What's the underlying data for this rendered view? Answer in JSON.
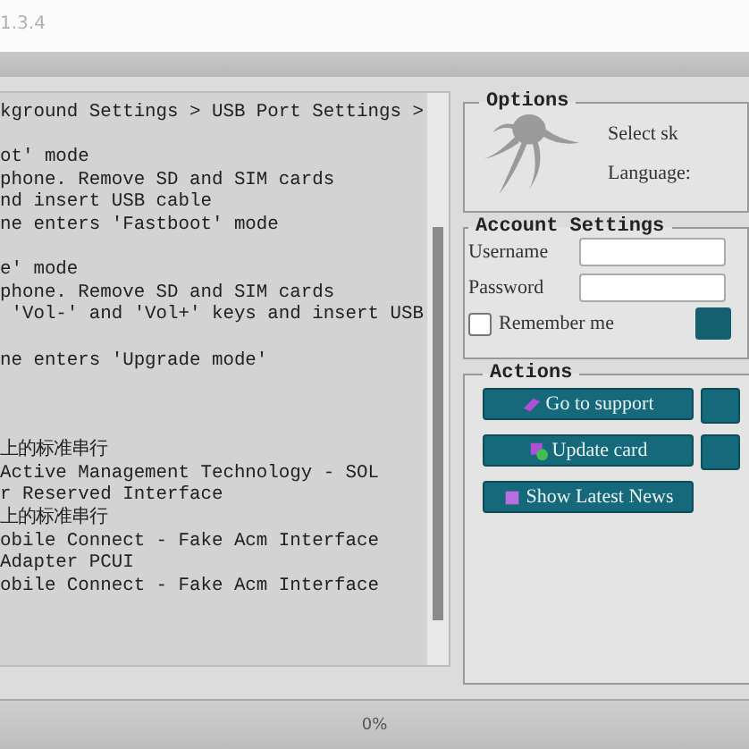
{
  "window": {
    "version": "1.3.4"
  },
  "log": {
    "paragraphs": [
      {
        "lines": [
          "kground Settings > USB Port Settings >"
        ]
      },
      {
        "lines": [
          "ot' mode",
          "phone. Remove SD and SIM cards",
          "nd insert USB cable",
          "ne enters 'Fastboot' mode"
        ]
      },
      {
        "lines": [
          "e' mode",
          "phone. Remove SD and SIM cards",
          " 'Vol-' and 'Vol+' keys and insert USB"
        ]
      },
      {
        "lines": [
          "ne enters 'Upgrade mode'"
        ]
      },
      {
        "lines": [
          "上的标准串行",
          "Active Management Technology - SOL",
          "r Reserved Interface",
          "上的标准串行",
          "obile Connect - Fake Acm Interface",
          "Adapter PCUI",
          "obile Connect - Fake Acm Interface"
        ]
      }
    ]
  },
  "options": {
    "title": "Options",
    "skin_label": "Select sk",
    "language_label": "Language:"
  },
  "account": {
    "title": "Account Settings",
    "username_label": "Username",
    "password_label": "Password",
    "remember": {
      "label": "Remember me",
      "checked": false
    }
  },
  "actions": {
    "title": "Actions",
    "buttons": [
      {
        "label": "Go to support",
        "kind": "support"
      },
      {
        "label": "Update card",
        "kind": "update"
      },
      {
        "label": "Show Latest News",
        "kind": "news"
      }
    ]
  },
  "status_bar": {
    "progress_text": "0%"
  }
}
